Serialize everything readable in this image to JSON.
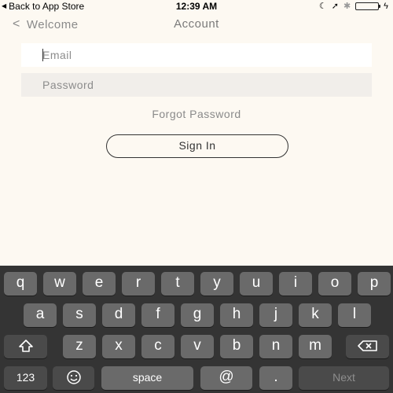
{
  "status_bar": {
    "back_label": "Back to App Store",
    "time": "12:39 AM",
    "icons": [
      "moon-icon",
      "location-arrow-icon",
      "bluetooth-icon",
      "battery-icon",
      "charging-icon"
    ],
    "battery_level": 1.0,
    "battery_color": "#4cd964"
  },
  "nav": {
    "back_label": "Welcome",
    "title": "Account"
  },
  "form": {
    "email_placeholder": "Email",
    "email_value": "",
    "password_placeholder": "Password",
    "password_value": "",
    "forgot_label": "Forgot Password",
    "signin_label": "Sign In"
  },
  "keyboard": {
    "row1": [
      "q",
      "w",
      "e",
      "r",
      "t",
      "y",
      "u",
      "i",
      "o",
      "p"
    ],
    "row2": [
      "a",
      "s",
      "d",
      "f",
      "g",
      "h",
      "j",
      "k",
      "l"
    ],
    "row3": [
      "z",
      "x",
      "c",
      "v",
      "b",
      "n",
      "m"
    ],
    "numbers_label": "123",
    "space_label": "space",
    "at_label": "@",
    "dot_label": ".",
    "next_label": "Next"
  }
}
